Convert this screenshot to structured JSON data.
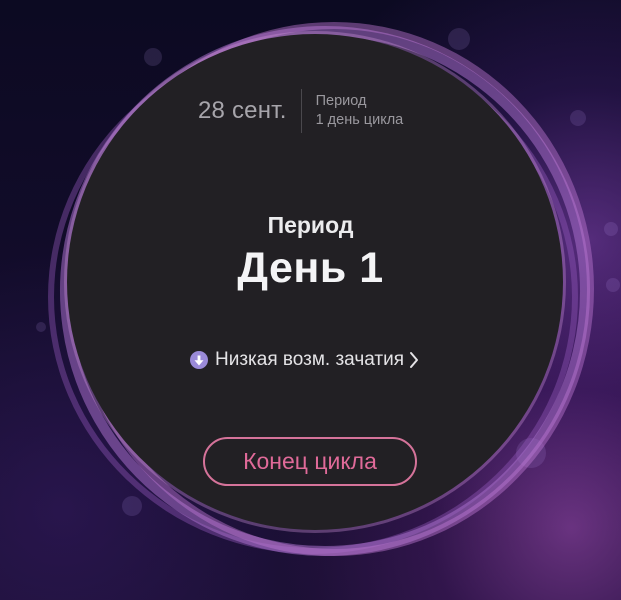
{
  "header": {
    "date": "28 сент.",
    "phase": "Период",
    "cycle_day": "1 день цикла"
  },
  "center": {
    "phase_title": "Период",
    "day_text": "День 1"
  },
  "fertility": {
    "icon": "arrow-down-icon",
    "text": "Низкая возм. зачатия"
  },
  "actions": {
    "end_cycle_label": "Конец цикла"
  },
  "colors": {
    "accent_pink": "#e06a99",
    "ring_purple": "#a56ec8",
    "dial_background": "#222024",
    "fertility_icon": "#9a8ad8"
  }
}
